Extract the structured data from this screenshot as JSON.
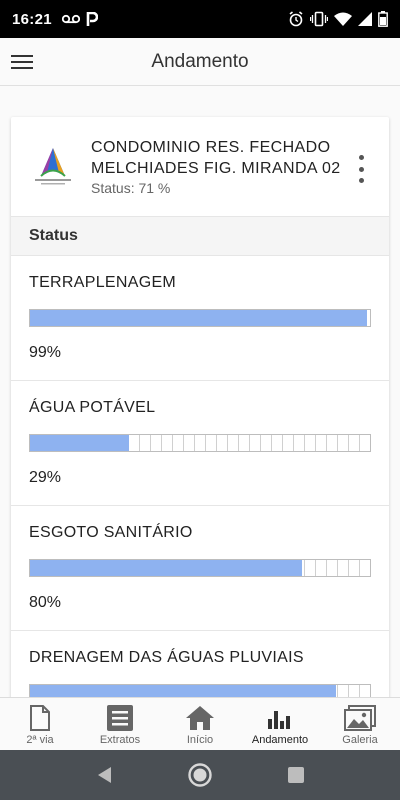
{
  "status_bar": {
    "time": "16:21",
    "left_icons": [
      "voicemail-icon",
      "parking-icon"
    ],
    "right_icons": [
      "alarm-icon",
      "vibrate-icon",
      "wifi-icon",
      "signal-icon",
      "battery-icon"
    ]
  },
  "app_bar": {
    "title": "Andamento",
    "menu_icon": "hamburger-menu-icon"
  },
  "card": {
    "logo_icon": "condominium-logo",
    "title": "CONDOMINIO RES. FECHADO MELCHIADES FIG. MIRANDA 02",
    "status": "Status: 71 %",
    "section_title": "Status",
    "items": [
      {
        "label": "TERRAPLENAGEM",
        "percent": 99,
        "percent_text": "99%"
      },
      {
        "label": "ÁGUA POTÁVEL",
        "percent": 29,
        "percent_text": "29%"
      },
      {
        "label": "ESGOTO SANITÁRIO",
        "percent": 80,
        "percent_text": "80%"
      },
      {
        "label": "DRENAGEM DAS ÁGUAS PLUVIAIS",
        "percent": 90,
        "percent_text": ""
      }
    ]
  },
  "bottom_nav": {
    "tabs": [
      {
        "label": "2ª via",
        "icon": "document-icon",
        "active": false
      },
      {
        "label": "Extratos",
        "icon": "list-icon",
        "active": false
      },
      {
        "label": "Início",
        "icon": "home-icon",
        "active": false
      },
      {
        "label": "Andamento",
        "icon": "bar-chart-icon",
        "active": true
      },
      {
        "label": "Galeria",
        "icon": "gallery-icon",
        "active": false
      }
    ]
  },
  "colors": {
    "progress_fill": "#8eb2f0",
    "system_nav": "#4a4f54"
  }
}
